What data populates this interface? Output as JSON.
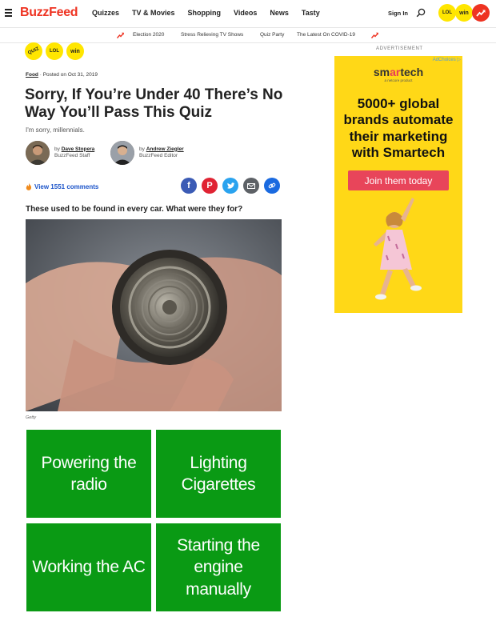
{
  "header": {
    "logo": "BuzzFeed",
    "nav": [
      "Quizzes",
      "TV & Movies",
      "Shopping",
      "Videos",
      "News",
      "Tasty"
    ],
    "signin": "Sign In",
    "badges": [
      "LOL",
      "win"
    ]
  },
  "trending": {
    "items": [
      "Election 2020",
      "Stress Relieving TV Shows",
      "Quiz Party",
      "The Latest On COVID-19"
    ]
  },
  "article": {
    "badges": [
      "QUIZ",
      "LOL",
      "win"
    ],
    "category": "Food",
    "posted": "Posted on Oct 31, 2019",
    "title": "Sorry, If You’re Under 40 There’s No Way You’ll Pass This Quiz",
    "subtitle": "I'm sorry, millennials.",
    "authors": [
      {
        "by": "by",
        "name": "Dave Stopera",
        "role": "BuzzFeed Staff"
      },
      {
        "by": "by",
        "name": "Andrew Ziegler",
        "role": "BuzzFeed Editor"
      }
    ],
    "comments": "View 1551 comments",
    "question": "These used to be found in every car. What were they for?",
    "image_credit": "Getty",
    "answers": [
      "Powering the radio",
      "Lighting Cigarettes",
      "Working the AC",
      "Starting the engine manually"
    ]
  },
  "ad": {
    "label": "ADVERTISEMENT",
    "adchoices": "AdChoices",
    "brand_prefix": "sm",
    "brand_mid": "ar",
    "brand_suffix": "tech",
    "tagline": "a netcore product",
    "headline": "5000+ global brands automate their marketing with Smartech",
    "cta": "Join them today"
  },
  "colors": {
    "brand_red": "#ee3322",
    "badge_yellow": "#ffe600",
    "answer_green": "#0a9a14",
    "link_blue": "#1a53c9",
    "ad_yellow": "#ffd817",
    "ad_pink": "#e8455a"
  }
}
